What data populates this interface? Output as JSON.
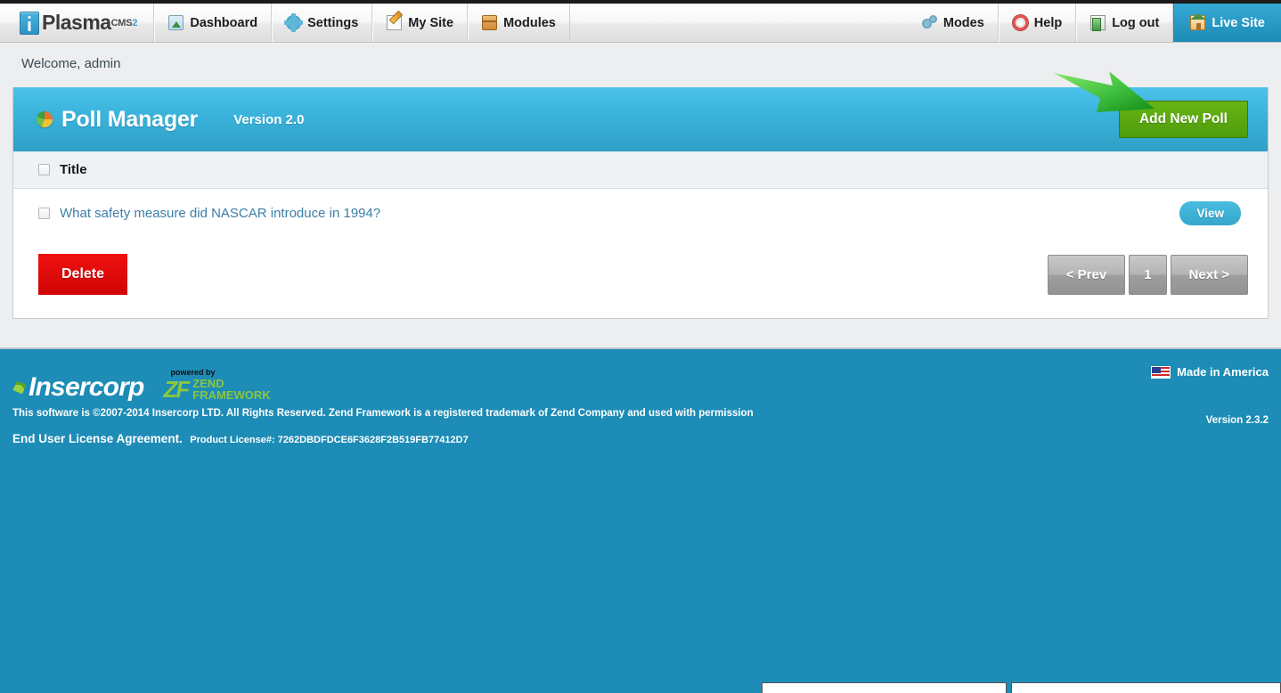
{
  "nav": {
    "brand": {
      "name": "Plasma",
      "sup": "CMS",
      "sup_num": "2",
      "icon": "info-logo-icon"
    },
    "left_items": [
      {
        "label": "Dashboard",
        "icon": "dashboard-icon"
      },
      {
        "label": "Settings",
        "icon": "gear-icon"
      },
      {
        "label": "My Site",
        "icon": "pencil-icon"
      },
      {
        "label": "Modules",
        "icon": "box-icon"
      }
    ],
    "right_items": [
      {
        "label": "Modes",
        "icon": "modes-gears-icon"
      },
      {
        "label": "Help",
        "icon": "lifering-icon"
      },
      {
        "label": "Log out",
        "icon": "logout-door-icon"
      },
      {
        "label": "Live Site",
        "icon": "home-icon"
      }
    ]
  },
  "welcome": "Welcome, admin",
  "panel": {
    "title": "Poll Manager",
    "version": "Version 2.0",
    "title_icon": "pie-chart-icon",
    "add_button": "Add New Poll",
    "accent_color": "#3bb4dd",
    "add_button_color": "#5aa610",
    "annotation": {
      "type": "arrow",
      "color": "#2da13a",
      "points_to": "Add New Poll"
    }
  },
  "table": {
    "columns": [
      "Title"
    ],
    "rows": [
      {
        "title": "What safety measure did NASCAR introduce in 1994?",
        "action": "View"
      }
    ],
    "delete_label": "Delete",
    "pager": {
      "prev": "< Prev",
      "page": "1",
      "next": "Next >"
    }
  },
  "footer": {
    "company": "Insercorp",
    "powered_by": "powered by",
    "zend_mark": "ZF",
    "zend_line1": "ZEND",
    "zend_line2": "FRAMEWORK",
    "copyright": "This software is ©2007-2014 Insercorp LTD. All Rights Reserved. Zend Framework is a registered trademark of Zend Company and used with permission",
    "eula": "End User License Agreement.",
    "license_label": "Product License#: 7262DBDFDCE6F3628F2B519FB77412D7",
    "made_in": "Made in America",
    "version": "Version 2.3.2",
    "bg_color": "#1d8cb6"
  }
}
